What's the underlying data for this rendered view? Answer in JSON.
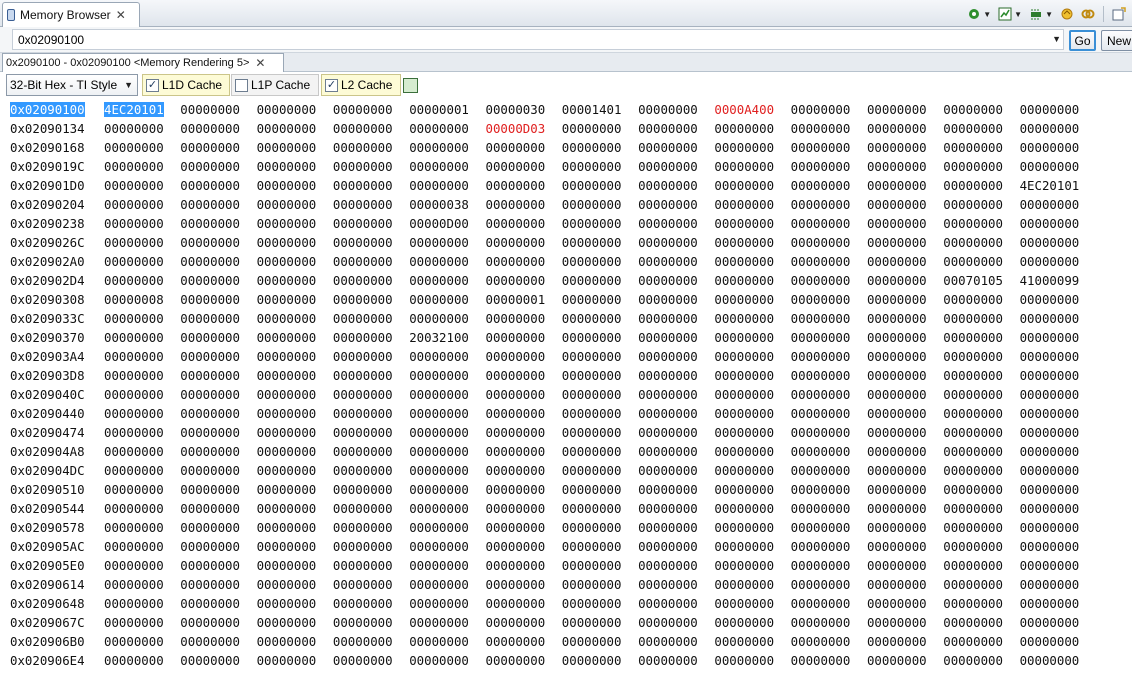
{
  "view_tab": {
    "title": "Memory Browser"
  },
  "address_bar": {
    "value": "0x02090100",
    "go_label": "Go",
    "new_label": "New"
  },
  "rendering_tab": {
    "label": "0x2090100 - 0x02090100 <Memory Rendering 5>"
  },
  "format": {
    "selected": "32-Bit Hex - TI Style"
  },
  "caches": [
    {
      "label": "L1D Cache",
      "checked": true
    },
    {
      "label": "L1P Cache",
      "checked": false
    },
    {
      "label": "L2 Cache",
      "checked": true
    }
  ],
  "memory": {
    "selected_row": 0,
    "selected_col": 0,
    "changed": [
      [
        0,
        8
      ],
      [
        1,
        5
      ]
    ],
    "rows": [
      [
        "0x02090100",
        "4EC20101 00000000 00000000 00000000 00000001 00000030 00001401 00000000 0000A400 00000000 00000000 00000000 00000000"
      ],
      [
        "0x02090134",
        "00000000 00000000 00000000 00000000 00000000 00000D03 00000000 00000000 00000000 00000000 00000000 00000000 00000000"
      ],
      [
        "0x02090168",
        "00000000 00000000 00000000 00000000 00000000 00000000 00000000 00000000 00000000 00000000 00000000 00000000 00000000"
      ],
      [
        "0x0209019C",
        "00000000 00000000 00000000 00000000 00000000 00000000 00000000 00000000 00000000 00000000 00000000 00000000 00000000"
      ],
      [
        "0x020901D0",
        "00000000 00000000 00000000 00000000 00000000 00000000 00000000 00000000 00000000 00000000 00000000 00000000 4EC20101"
      ],
      [
        "0x02090204",
        "00000000 00000000 00000000 00000000 00000038 00000000 00000000 00000000 00000000 00000000 00000000 00000000 00000000"
      ],
      [
        "0x02090238",
        "00000000 00000000 00000000 00000000 00000D00 00000000 00000000 00000000 00000000 00000000 00000000 00000000 00000000"
      ],
      [
        "0x0209026C",
        "00000000 00000000 00000000 00000000 00000000 00000000 00000000 00000000 00000000 00000000 00000000 00000000 00000000"
      ],
      [
        "0x020902A0",
        "00000000 00000000 00000000 00000000 00000000 00000000 00000000 00000000 00000000 00000000 00000000 00000000 00000000"
      ],
      [
        "0x020902D4",
        "00000000 00000000 00000000 00000000 00000000 00000000 00000000 00000000 00000000 00000000 00000000 00070105 41000099"
      ],
      [
        "0x02090308",
        "00000008 00000000 00000000 00000000 00000000 00000001 00000000 00000000 00000000 00000000 00000000 00000000 00000000"
      ],
      [
        "0x0209033C",
        "00000000 00000000 00000000 00000000 00000000 00000000 00000000 00000000 00000000 00000000 00000000 00000000 00000000"
      ],
      [
        "0x02090370",
        "00000000 00000000 00000000 00000000 20032100 00000000 00000000 00000000 00000000 00000000 00000000 00000000 00000000"
      ],
      [
        "0x020903A4",
        "00000000 00000000 00000000 00000000 00000000 00000000 00000000 00000000 00000000 00000000 00000000 00000000 00000000"
      ],
      [
        "0x020903D8",
        "00000000 00000000 00000000 00000000 00000000 00000000 00000000 00000000 00000000 00000000 00000000 00000000 00000000"
      ],
      [
        "0x0209040C",
        "00000000 00000000 00000000 00000000 00000000 00000000 00000000 00000000 00000000 00000000 00000000 00000000 00000000"
      ],
      [
        "0x02090440",
        "00000000 00000000 00000000 00000000 00000000 00000000 00000000 00000000 00000000 00000000 00000000 00000000 00000000"
      ],
      [
        "0x02090474",
        "00000000 00000000 00000000 00000000 00000000 00000000 00000000 00000000 00000000 00000000 00000000 00000000 00000000"
      ],
      [
        "0x020904A8",
        "00000000 00000000 00000000 00000000 00000000 00000000 00000000 00000000 00000000 00000000 00000000 00000000 00000000"
      ],
      [
        "0x020904DC",
        "00000000 00000000 00000000 00000000 00000000 00000000 00000000 00000000 00000000 00000000 00000000 00000000 00000000"
      ],
      [
        "0x02090510",
        "00000000 00000000 00000000 00000000 00000000 00000000 00000000 00000000 00000000 00000000 00000000 00000000 00000000"
      ],
      [
        "0x02090544",
        "00000000 00000000 00000000 00000000 00000000 00000000 00000000 00000000 00000000 00000000 00000000 00000000 00000000"
      ],
      [
        "0x02090578",
        "00000000 00000000 00000000 00000000 00000000 00000000 00000000 00000000 00000000 00000000 00000000 00000000 00000000"
      ],
      [
        "0x020905AC",
        "00000000 00000000 00000000 00000000 00000000 00000000 00000000 00000000 00000000 00000000 00000000 00000000 00000000"
      ],
      [
        "0x020905E0",
        "00000000 00000000 00000000 00000000 00000000 00000000 00000000 00000000 00000000 00000000 00000000 00000000 00000000"
      ],
      [
        "0x02090614",
        "00000000 00000000 00000000 00000000 00000000 00000000 00000000 00000000 00000000 00000000 00000000 00000000 00000000"
      ],
      [
        "0x02090648",
        "00000000 00000000 00000000 00000000 00000000 00000000 00000000 00000000 00000000 00000000 00000000 00000000 00000000"
      ],
      [
        "0x0209067C",
        "00000000 00000000 00000000 00000000 00000000 00000000 00000000 00000000 00000000 00000000 00000000 00000000 00000000"
      ],
      [
        "0x020906B0",
        "00000000 00000000 00000000 00000000 00000000 00000000 00000000 00000000 00000000 00000000 00000000 00000000 00000000"
      ],
      [
        "0x020906E4",
        "00000000 00000000 00000000 00000000 00000000 00000000 00000000 00000000 00000000 00000000 00000000 00000000 00000000"
      ]
    ]
  },
  "colors": {
    "selection": "#3399ff",
    "changed": "#e02020"
  }
}
